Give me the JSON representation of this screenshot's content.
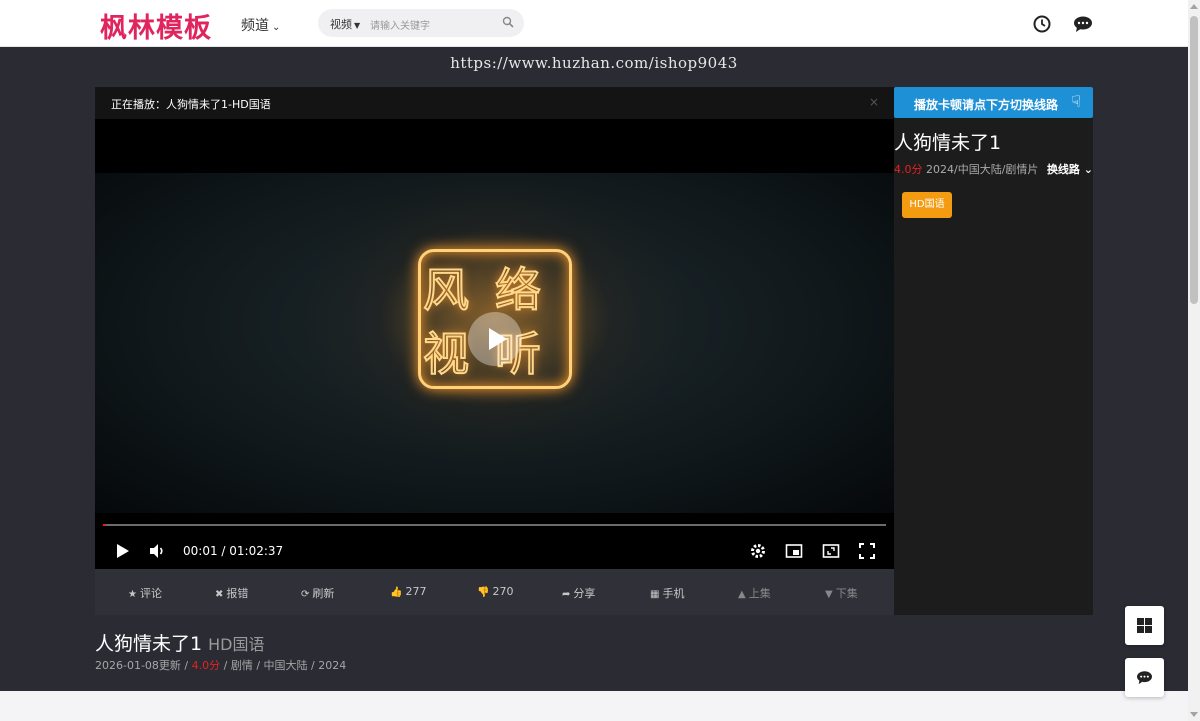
{
  "header": {
    "logo": "枫林模板",
    "channel_label": "频道",
    "search": {
      "category": "视频",
      "placeholder": "请输入关键字"
    },
    "icons": [
      "history-icon",
      "comments-icon"
    ]
  },
  "watermark": "https://www.huzhan.com/ishop9043",
  "player": {
    "now_playing": "正在播放：人狗情未了1-HD国语",
    "close_glyph": "×",
    "time": "00:01 / 01:02:37",
    "progress_fraction": 0.0003,
    "actions": [
      {
        "icon": "★",
        "label": "评论"
      },
      {
        "icon": "✖",
        "label": "报错"
      },
      {
        "icon": "⟳",
        "label": "刷新"
      },
      {
        "icon": "👍",
        "label": "277"
      },
      {
        "icon": "👎",
        "label": "270"
      },
      {
        "icon": "➦",
        "label": "分享"
      },
      {
        "icon": "▦",
        "label": "手机"
      },
      {
        "icon": "▲",
        "label": "上集"
      },
      {
        "icon": "▼",
        "label": "下集"
      }
    ]
  },
  "side": {
    "tip_button": "播放卡顿请点下方切换线路",
    "title": "人狗情未了1",
    "score": "4.0分",
    "meta": "2024/中国大陆/剧情片",
    "switch_label": "换线路",
    "line_button": "HD国语"
  },
  "info": {
    "title": "人狗情未了1",
    "subtitle": "HD国语",
    "updated": "2026-01-08更新",
    "score": "4.0分",
    "genre": "剧情",
    "region": "中国大陆",
    "year": "2024"
  },
  "colors": {
    "accent_pink": "#e0245e",
    "blue_button": "#1e90d6",
    "orange_button": "#f39c12",
    "score_red": "#e42222"
  }
}
